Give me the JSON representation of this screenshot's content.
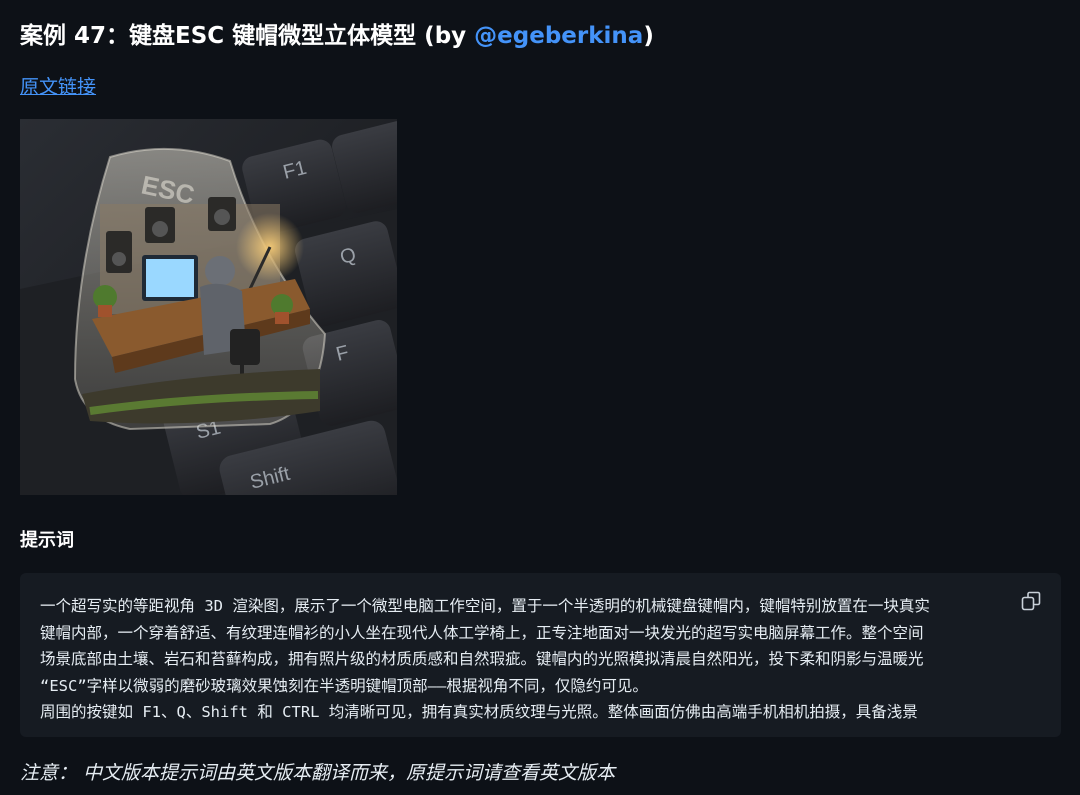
{
  "header": {
    "title_prefix": "案例 47：键盘ESC 键帽微型立体模型 (by ",
    "author_handle": "@egeberkina",
    "title_suffix": ")"
  },
  "source_link": "原文链接",
  "hero_image": {
    "keycaps": {
      "esc": "ESC",
      "f1": "F1",
      "q": "Q",
      "f": "F",
      "s1": "S1",
      "shift": "Shift"
    }
  },
  "prompt_section": {
    "heading": "提示词",
    "lines": [
      "一个超写实的等距视角 3D 渲染图，展示了一个微型电脑工作空间，置于一个半透明的机械键盘键帽内，键帽特别放置在一块真实",
      "键帽内部，一个穿着舒适、有纹理连帽衫的小人坐在现代人体工学椅上，正专注地面对一块发光的超写实电脑屏幕工作。整个空间",
      "场景底部由土壤、岩石和苔藓构成，拥有照片级的材质质感和自然瑕疵。键帽内的光照模拟清晨自然阳光，投下柔和阴影与温暖光",
      "“ESC”字样以微弱的磨砂玻璃效果蚀刻在半透明键帽顶部——根据视角不同，仅隐约可见。",
      "周围的按键如 F1、Q、Shift 和 CTRL 均清晰可见，拥有真实材质纹理与光照。整体画面仿佛由高端手机相机拍摄，具备浅景"
    ],
    "copy_icon": "copy-icon"
  },
  "note": "注意： 中文版本提示词由英文版本翻译而来，原提示词请查看英文版本",
  "colors": {
    "background": "#0d1117",
    "code_background": "#161b22",
    "link": "#4493f8",
    "text": "#e6edf3"
  }
}
